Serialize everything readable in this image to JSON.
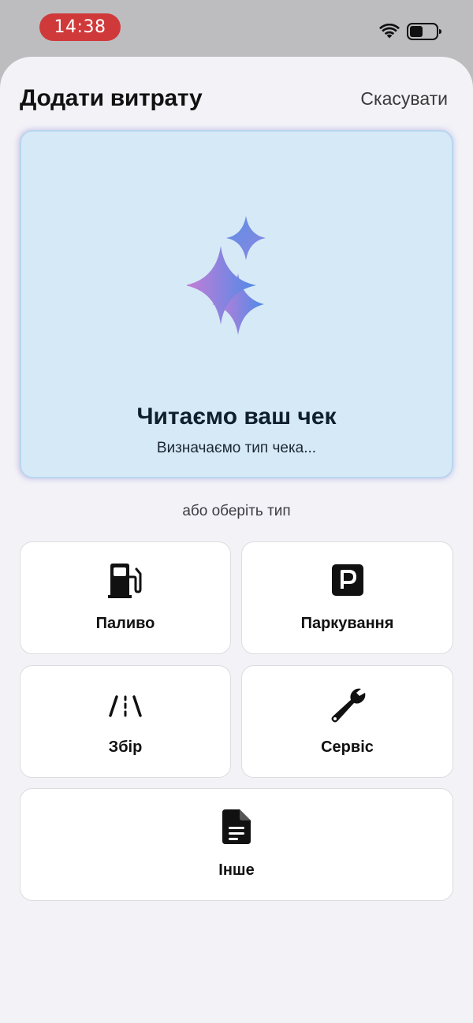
{
  "status_bar": {
    "time": "14:38"
  },
  "header": {
    "title": "Додати витрату",
    "cancel_label": "Скасувати"
  },
  "scan": {
    "title": "Читаємо ваш чек",
    "subtitle": "Визначаємо тип чека..."
  },
  "or_label": "або оберіть тип",
  "types": [
    {
      "label": "Паливо",
      "icon": "fuel-pump-icon"
    },
    {
      "label": "Паркування",
      "icon": "parking-icon"
    },
    {
      "label": "Збір",
      "icon": "road-toll-icon"
    },
    {
      "label": "Сервіс",
      "icon": "wrench-icon"
    },
    {
      "label": "Інше",
      "icon": "document-icon"
    }
  ],
  "colors": {
    "time_pill": "#d0393a",
    "sheet_bg": "#f2f2f7",
    "scan_card_bg": "#d6e9f6",
    "sparkle_gradient": [
      "#c77dd6",
      "#4f8ae8"
    ]
  }
}
